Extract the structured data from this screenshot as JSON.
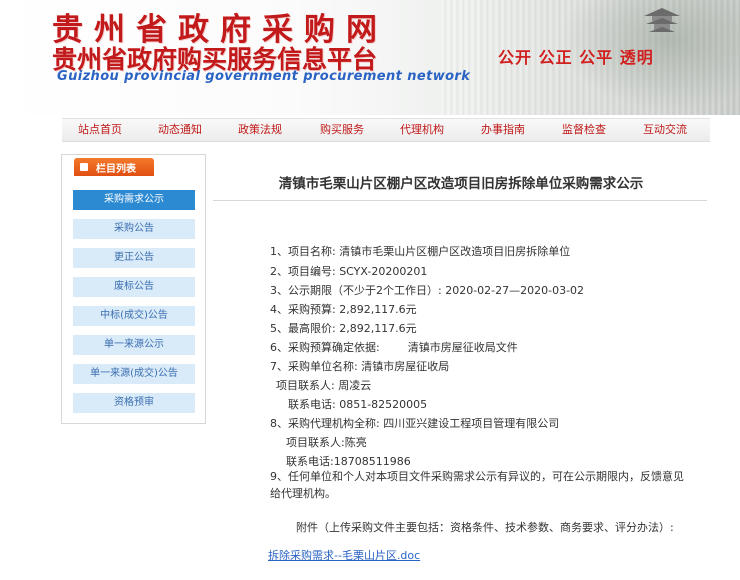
{
  "header": {
    "title_cn": "贵州省政府采购网",
    "subtitle_cn": "贵州省政府购买服务信息平台",
    "title_en": "Guizhou provincial government procurement network",
    "slogan": "公开 公正 公平 透明",
    "colors": {
      "red": "#c2191a",
      "blue": "#2a63c4"
    }
  },
  "nav": {
    "items": [
      "站点首页",
      "动态通知",
      "政策法规",
      "购买服务",
      "代理机构",
      "办事指南",
      "监督检查",
      "互动交流"
    ]
  },
  "sidebar": {
    "header_label": "栏目列表",
    "items": [
      "采购需求公示",
      "采购公告",
      "更正公告",
      "废标公告",
      "中标(成交)公告",
      "单一来源公示",
      "单一来源(成交)公告",
      "资格预审"
    ],
    "active_index": 0
  },
  "main": {
    "title": "清镇市毛栗山片区棚户区改造项目旧房拆除单位采购需求公示",
    "lines": [
      "1、项目名称: 清镇市毛栗山片区棚户区改造项目旧房拆除单位",
      "2、项目编号: SCYX-20200201",
      "3、公示期限（不少于2个工作日）: 2020-02-27—2020-03-02",
      "4、采购预算: 2,892,117.6元",
      "5、最高限价: 2,892,117.6元",
      "6、采购预算确定依据:",
      "7、采购单位名称: 清镇市房屋征收局",
      "项目联系人: 周凌云",
      "联系电话: 0851-82520005",
      "8、采购代理机构全称: 四川亚兴建设工程项目管理有限公司",
      "项目联系人:陈亮",
      "联系电话:18708511986"
    ],
    "budget_basis": "清镇市房屋征收局文件",
    "note_9": "9、任何单位和个人对本项目文件采购需求公示有异议的，可在公示期限内，反馈意见给代理机构。",
    "attachment_heading": "附件（上传采购文件主要包括：资格条件、技术参数、商务要求、评分办法）:",
    "attachment_link": "拆除采购需求--毛栗山片区.doc"
  }
}
